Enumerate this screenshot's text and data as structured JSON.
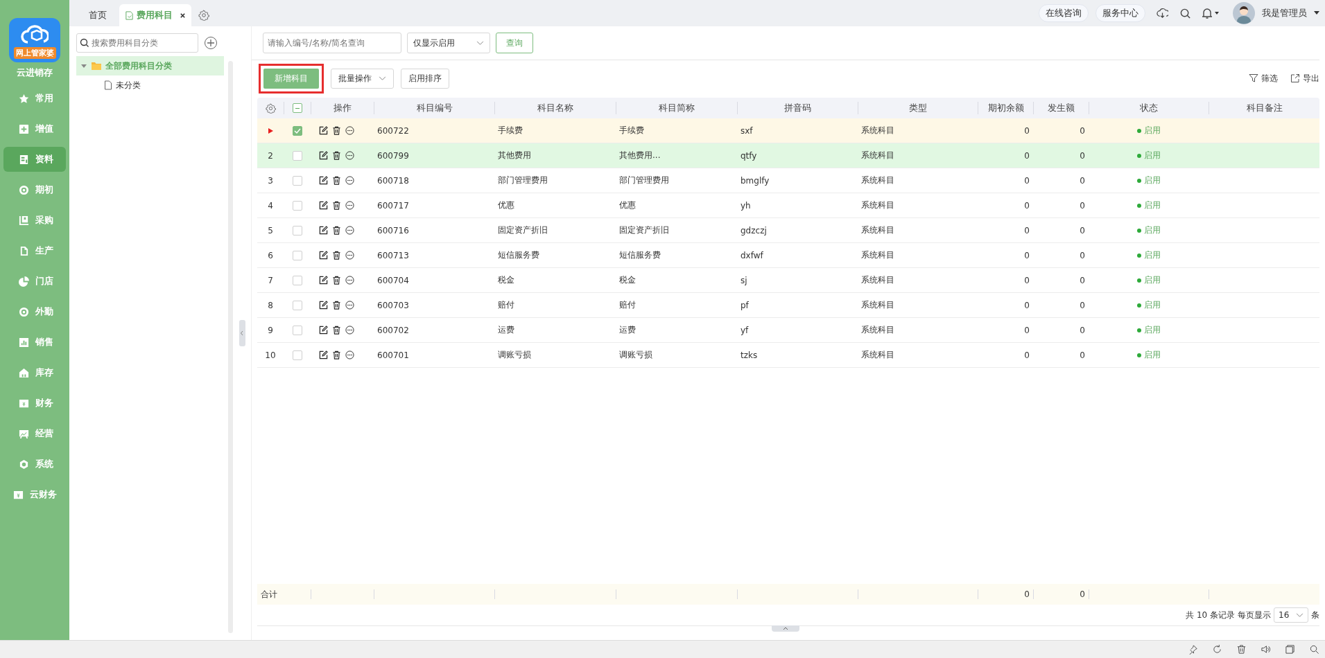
{
  "nav": {
    "logo_badge": "网上管家婆",
    "app_name": "云进销存",
    "items": [
      {
        "label": "常用",
        "selected": false
      },
      {
        "label": "增值",
        "selected": false
      },
      {
        "label": "资料",
        "selected": true
      },
      {
        "label": "期初",
        "selected": false
      },
      {
        "label": "采购",
        "selected": false
      },
      {
        "label": "生产",
        "selected": false
      },
      {
        "label": "门店",
        "selected": false
      },
      {
        "label": "外勤",
        "selected": false
      },
      {
        "label": "销售",
        "selected": false
      },
      {
        "label": "库存",
        "selected": false
      },
      {
        "label": "财务",
        "selected": false
      },
      {
        "label": "经营",
        "selected": false
      },
      {
        "label": "系统",
        "selected": false
      },
      {
        "label": "云财务",
        "selected": false
      }
    ]
  },
  "tabs": [
    {
      "label": "首页",
      "selected": false,
      "closable": false
    },
    {
      "label": "费用科目",
      "selected": true,
      "closable": true
    }
  ],
  "header": {
    "buttons": [
      "在线咨询",
      "服务中心"
    ],
    "user": "我是管理员"
  },
  "tree": {
    "search_placeholder": "搜索费用科目分类",
    "nodes": [
      {
        "label": "全部费用科目分类",
        "selected": true,
        "expanded": true,
        "children": [
          {
            "label": "未分类",
            "selected": false
          }
        ]
      }
    ]
  },
  "filter": {
    "placeholder": "请输入编号/名称/简名查询",
    "select": "仅显示启用",
    "button": "查询"
  },
  "toolbar": {
    "add": "新增科目",
    "batch": "批量操作",
    "sort": "启用排序",
    "filter": "筛选",
    "export": "导出"
  },
  "table": {
    "header_checkbox_indeterminate": true,
    "columns": [
      "操作",
      "科目编号",
      "科目名称",
      "科目简称",
      "拼音码",
      "类型",
      "期初余额",
      "发生额",
      "状态",
      "科目备注"
    ],
    "rows": [
      {
        "current": true,
        "checked": true,
        "highlighted": false,
        "code": "600722",
        "name": "手续费",
        "short_name": "手续费",
        "pinyin": "sxf",
        "type": "系统科目",
        "opening_balance": "0",
        "amount": "0",
        "status": "启用"
      },
      {
        "index": "2",
        "current": false,
        "checked": false,
        "highlighted": true,
        "code": "600799",
        "name": "其他费用",
        "short_name": "其他费用...",
        "pinyin": "qtfy",
        "type": "系统科目",
        "opening_balance": "0",
        "amount": "0",
        "status": "启用"
      },
      {
        "index": "3",
        "current": false,
        "checked": false,
        "highlighted": false,
        "code": "600718",
        "name": "部门管理费用",
        "short_name": "部门管理费用",
        "pinyin": "bmglfy",
        "type": "系统科目",
        "opening_balance": "0",
        "amount": "0",
        "status": "启用"
      },
      {
        "index": "4",
        "current": false,
        "checked": false,
        "highlighted": false,
        "code": "600717",
        "name": "优惠",
        "short_name": "优惠",
        "pinyin": "yh",
        "type": "系统科目",
        "opening_balance": "0",
        "amount": "0",
        "status": "启用"
      },
      {
        "index": "5",
        "current": false,
        "checked": false,
        "highlighted": false,
        "code": "600716",
        "name": "固定资产折旧",
        "short_name": "固定资产折旧",
        "pinyin": "gdzczj",
        "type": "系统科目",
        "opening_balance": "0",
        "amount": "0",
        "status": "启用"
      },
      {
        "index": "6",
        "current": false,
        "checked": false,
        "highlighted": false,
        "code": "600713",
        "name": "短信服务费",
        "short_name": "短信服务费",
        "pinyin": "dxfwf",
        "type": "系统科目",
        "opening_balance": "0",
        "amount": "0",
        "status": "启用"
      },
      {
        "index": "7",
        "current": false,
        "checked": false,
        "highlighted": false,
        "code": "600704",
        "name": "税金",
        "short_name": "税金",
        "pinyin": "sj",
        "type": "系统科目",
        "opening_balance": "0",
        "amount": "0",
        "status": "启用"
      },
      {
        "index": "8",
        "current": false,
        "checked": false,
        "highlighted": false,
        "code": "600703",
        "name": "赔付",
        "short_name": "赔付",
        "pinyin": "pf",
        "type": "系统科目",
        "opening_balance": "0",
        "amount": "0",
        "status": "启用"
      },
      {
        "index": "9",
        "current": false,
        "checked": false,
        "highlighted": false,
        "code": "600702",
        "name": "运费",
        "short_name": "运费",
        "pinyin": "yf",
        "type": "系统科目",
        "opening_balance": "0",
        "amount": "0",
        "status": "启用"
      },
      {
        "index": "10",
        "current": false,
        "checked": false,
        "highlighted": false,
        "code": "600701",
        "name": "调账亏损",
        "short_name": "调账亏损",
        "pinyin": "tzks",
        "type": "系统科目",
        "opening_balance": "0",
        "amount": "0",
        "status": "启用"
      }
    ],
    "totals": {
      "label": "合计",
      "opening_balance": "0",
      "amount": "0"
    }
  },
  "pager": {
    "summary": "共 10 条记录",
    "per_page_label": "每页显示",
    "per_page": "16",
    "unit": "条"
  }
}
